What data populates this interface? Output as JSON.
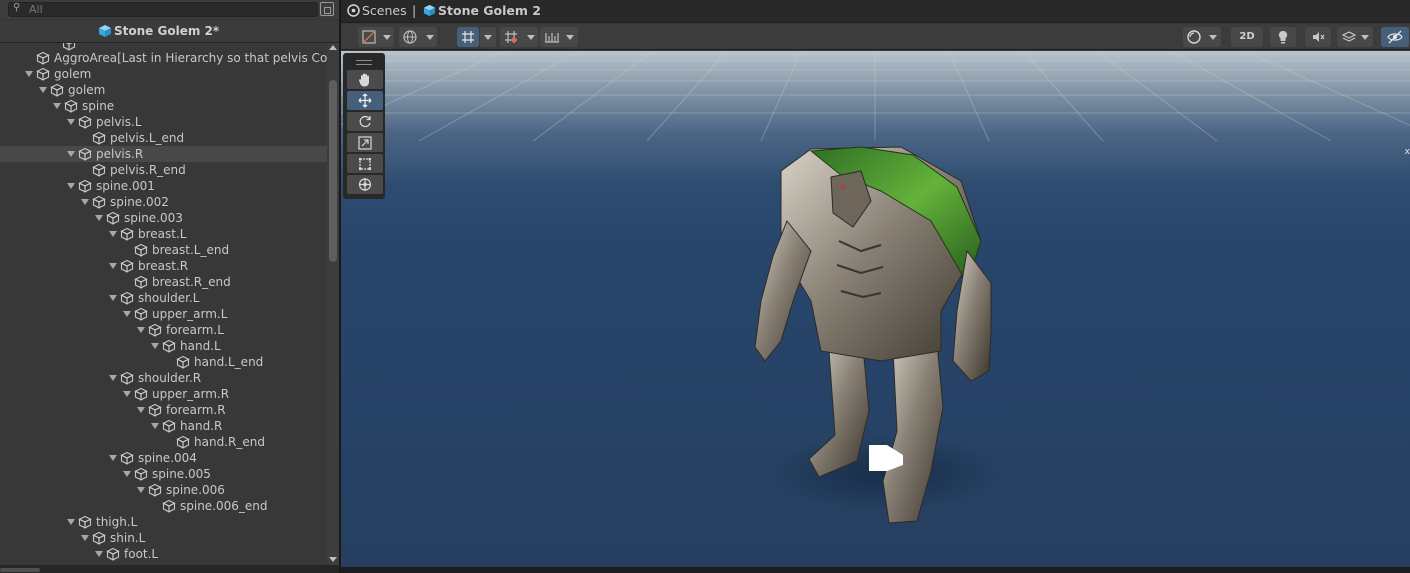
{
  "hierarchy": {
    "search": {
      "placeholder": "All",
      "value": ""
    },
    "scene_title": "Stone Golem 2*",
    "rows": [
      {
        "label": "AggroArea[Last in Hierarchy so that pelvis Collid",
        "depth": 1,
        "expandable": false
      },
      {
        "label": "golem",
        "depth": 1,
        "expandable": true
      },
      {
        "label": "golem",
        "depth": 2,
        "expandable": true
      },
      {
        "label": "spine",
        "depth": 3,
        "expandable": true
      },
      {
        "label": "pelvis.L",
        "depth": 4,
        "expandable": true
      },
      {
        "label": "pelvis.L_end",
        "depth": 5,
        "expandable": false
      },
      {
        "label": "pelvis.R",
        "depth": 4,
        "expandable": true,
        "selected": true
      },
      {
        "label": "pelvis.R_end",
        "depth": 5,
        "expandable": false
      },
      {
        "label": "spine.001",
        "depth": 4,
        "expandable": true
      },
      {
        "label": "spine.002",
        "depth": 5,
        "expandable": true
      },
      {
        "label": "spine.003",
        "depth": 6,
        "expandable": true
      },
      {
        "label": "breast.L",
        "depth": 7,
        "expandable": true
      },
      {
        "label": "breast.L_end",
        "depth": 8,
        "expandable": false
      },
      {
        "label": "breast.R",
        "depth": 7,
        "expandable": true
      },
      {
        "label": "breast.R_end",
        "depth": 8,
        "expandable": false
      },
      {
        "label": "shoulder.L",
        "depth": 7,
        "expandable": true
      },
      {
        "label": "upper_arm.L",
        "depth": 8,
        "expandable": true
      },
      {
        "label": "forearm.L",
        "depth": 9,
        "expandable": true
      },
      {
        "label": "hand.L",
        "depth": 10,
        "expandable": true
      },
      {
        "label": "hand.L_end",
        "depth": 11,
        "expandable": false
      },
      {
        "label": "shoulder.R",
        "depth": 7,
        "expandable": true
      },
      {
        "label": "upper_arm.R",
        "depth": 8,
        "expandable": true
      },
      {
        "label": "forearm.R",
        "depth": 9,
        "expandable": true
      },
      {
        "label": "hand.R",
        "depth": 10,
        "expandable": true
      },
      {
        "label": "hand.R_end",
        "depth": 11,
        "expandable": false
      },
      {
        "label": "spine.004",
        "depth": 7,
        "expandable": true
      },
      {
        "label": "spine.005",
        "depth": 8,
        "expandable": true
      },
      {
        "label": "spine.006",
        "depth": 9,
        "expandable": true
      },
      {
        "label": "spine.006_end",
        "depth": 10,
        "expandable": false
      },
      {
        "label": "thigh.L",
        "depth": 4,
        "expandable": true
      },
      {
        "label": "shin.L",
        "depth": 5,
        "expandable": true
      },
      {
        "label": "foot.L",
        "depth": 6,
        "expandable": true
      }
    ]
  },
  "scene_view": {
    "breadcrumb": {
      "root": "Scenes",
      "separator": "|",
      "current": "Stone Golem 2"
    },
    "toolbar": {
      "mode_2d_label": "2D"
    },
    "viewport_close": "x",
    "tools": [
      "hand-tool",
      "move-tool",
      "rotate-tool",
      "scale-tool",
      "rect-tool",
      "transform-tool"
    ],
    "active_tool": "move-tool"
  },
  "colors": {
    "panel": "#383838",
    "selection": "#484848",
    "accent_active": "#46607c",
    "cube_icon": "#6bc4f0",
    "sky_top": "#b8c3cb",
    "sky_bottom": "#263f60"
  }
}
